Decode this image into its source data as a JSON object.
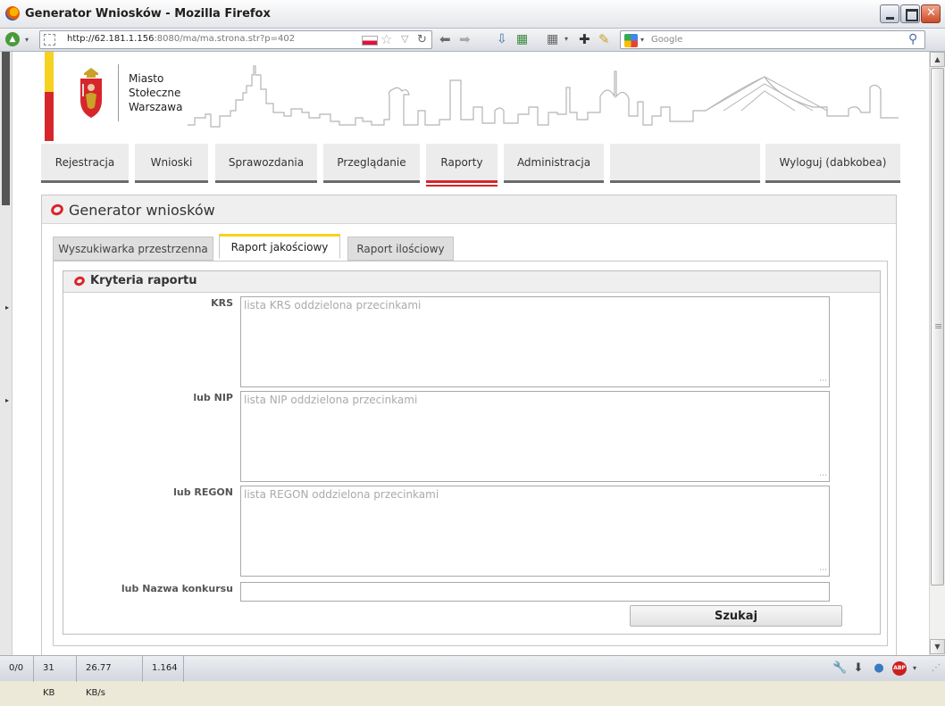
{
  "window": {
    "title": "Generator Wniosków - Mozilla Firefox"
  },
  "navbar": {
    "url_host": "http://62.181.1.156",
    "url_rest": ":8080/ma/ma.strona.str?p=402",
    "search_engine": "Google"
  },
  "brand": {
    "line1": "Miasto",
    "line2": "Stołeczne",
    "line3": "Warszawa"
  },
  "menu": [
    {
      "label": "Rejestracja"
    },
    {
      "label": "Wnioski"
    },
    {
      "label": "Sprawozdania"
    },
    {
      "label": "Przeglądanie"
    },
    {
      "label": "Raporty",
      "active": true
    },
    {
      "label": "Administracja"
    },
    {
      "label": ""
    },
    {
      "label": "Wyloguj (dabkobea)"
    }
  ],
  "panel": {
    "title": "Generator wniosków"
  },
  "tabs": [
    {
      "label": "Wyszukiwarka przestrzenna"
    },
    {
      "label": "Raport jakościowy",
      "active": true
    },
    {
      "label": "Raport ilościowy"
    }
  ],
  "criteria": {
    "title": "Kryteria raportu",
    "krs_label": "KRS",
    "krs_placeholder": "lista KRS oddzielona przecinkami",
    "nip_label": "lub NIP",
    "nip_placeholder": "lista NIP oddzielona przecinkami",
    "regon_label": "lub REGON",
    "regon_placeholder": "lista REGON oddzielona przecinkami",
    "contest_label": "lub Nazwa konkursu",
    "contest_value": "",
    "search_button": "Szukaj"
  },
  "status": {
    "counter": "0/0",
    "size": "31 KB",
    "speed": "26.77 KB/s",
    "time": "1.164"
  },
  "colors": {
    "brand_red": "#d7262b",
    "brand_yellow": "#f5d21f"
  }
}
